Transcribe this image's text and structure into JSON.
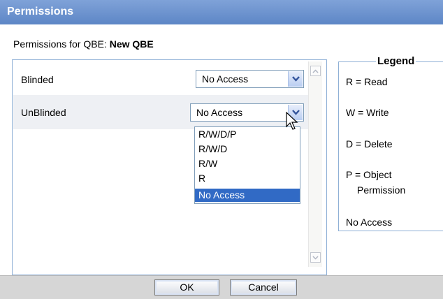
{
  "window": {
    "title": "Permissions"
  },
  "subtitle": {
    "prefix": "Permissions for QBE:",
    "name": "New QBE"
  },
  "rows": [
    {
      "label": "Blinded",
      "value": "No Access"
    },
    {
      "label": "UnBlinded",
      "value": "No Access"
    }
  ],
  "dropdown": {
    "options": [
      "R/W/D/P",
      "R/W/D",
      "R/W",
      "R",
      "No Access"
    ],
    "selected": "No Access"
  },
  "legend": {
    "title": "Legend",
    "items": [
      "R = Read",
      "W = Write",
      "D = Delete",
      "P = Object",
      "Permission",
      "No Access"
    ]
  },
  "buttons": {
    "ok": "OK",
    "cancel": "Cancel"
  },
  "colors": {
    "titlebar": "#6b91cf",
    "selection": "#316ac5",
    "border": "#8fb0d6"
  }
}
